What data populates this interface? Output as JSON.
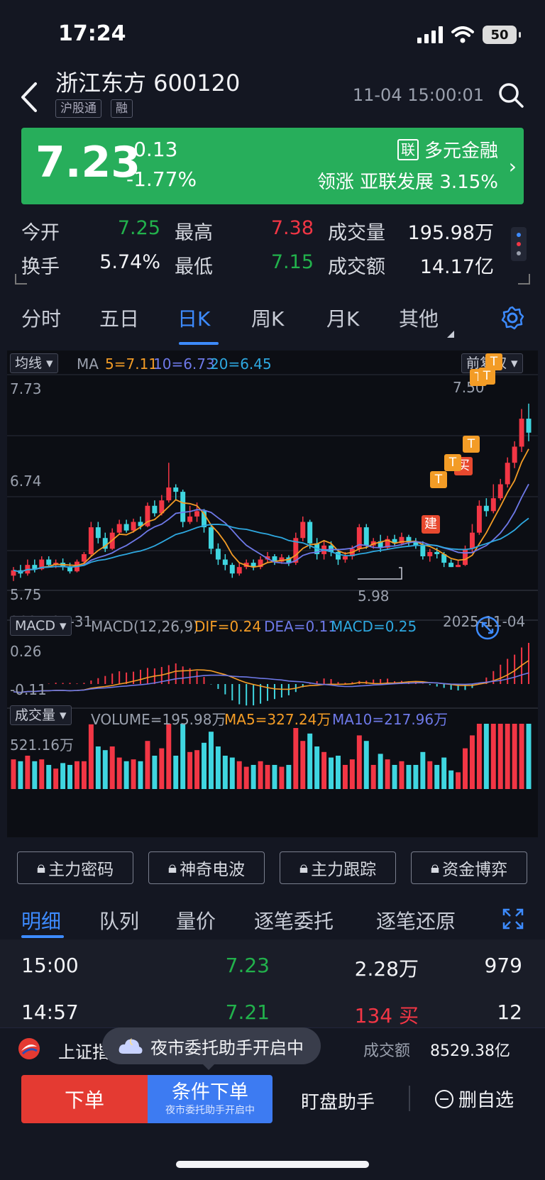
{
  "status": {
    "time": "17:24",
    "battery": "50"
  },
  "header": {
    "name": "浙江东方 600120",
    "tags": [
      "沪股通",
      "融"
    ],
    "datetime": "11-04 15:00:01"
  },
  "quote": {
    "price": "7.23",
    "change": "-0.13",
    "change_pct": "-1.77%",
    "sector_badge": "联",
    "sector_name": "多元金融",
    "lead_label": "领涨",
    "lead_stock": "亚联发展",
    "lead_pct": "3.15%"
  },
  "stats": [
    {
      "label": "今开",
      "value": "7.25"
    },
    {
      "label": "最高",
      "value": "7.38"
    },
    {
      "label": "成交量",
      "value": "195.98万"
    },
    {
      "label": "换手",
      "value": "5.74%"
    },
    {
      "label": "最低",
      "value": "7.15"
    },
    {
      "label": "成交额",
      "value": "14.17亿"
    }
  ],
  "period_tabs": [
    "分时",
    "五日",
    "日K",
    "周K",
    "月K",
    "其他"
  ],
  "chart": {
    "ma_dropdown": "均线",
    "ma_label": "MA",
    "ma5": "5=7.11",
    "ma10": "10=6.73",
    "ma20": "20=6.45",
    "adjust": "前复权",
    "price_ticks": [
      "7.73",
      "6.74",
      "5.75"
    ],
    "high_mark": "7.50",
    "low_mark": "5.98",
    "date_start": "2025-07-31",
    "date_end": "2025-11-04",
    "signal_build": "建",
    "signal_buy": "买",
    "signal_t": "T",
    "macd_dropdown": "MACD",
    "macd_label": "MACD(12,26,9)",
    "dif": "DIF=0.24",
    "dea": "DEA=0.11",
    "macd": "MACD=0.25",
    "macd_top": "0.26",
    "macd_bottom": "-0.11",
    "vol_dropdown": "成交量",
    "vol_label": "VOLUME=195.98万",
    "vol_ma5": "MA5=327.24万",
    "vol_ma10": "MA10=217.96万",
    "vol_top": "521.16万"
  },
  "features": [
    "主力密码",
    "神奇电波",
    "主力跟踪",
    "资金博弈"
  ],
  "detail_tabs": [
    "明细",
    "队列",
    "量价",
    "逐笔委托",
    "逐笔还原"
  ],
  "trades": [
    {
      "time": "15:00",
      "price": "7.23",
      "volume": "2.28万",
      "count": "979"
    },
    {
      "time": "14:57",
      "price": "7.21",
      "volume": "134 买",
      "count": "12"
    }
  ],
  "index_bar": {
    "name": "上证指",
    "turnover_label": "成交额",
    "turnover_value": "8529.38亿",
    "tooltip": "夜市委托助手开启中"
  },
  "bottom": {
    "order": "下单",
    "conditional": "条件下单",
    "conditional_sub": "夜市委托助手开启中",
    "monitor": "盯盘助手",
    "remove": "删自选"
  },
  "colors": {
    "up": "#f23645",
    "down": "#22b14c",
    "accent": "#3d8bff",
    "banner": "#27ae5b"
  },
  "chart_data": {
    "type": "candlestick",
    "title": "",
    "x_range": [
      "2025-07-31",
      "2025-11-04"
    ],
    "ylim": [
      5.75,
      7.73
    ],
    "candles": [
      [
        5.9,
        5.95,
        5.85,
        5.98
      ],
      [
        5.95,
        5.92,
        5.88,
        6.0
      ],
      [
        5.92,
        6.0,
        5.9,
        6.05
      ],
      [
        6.0,
        5.96,
        5.93,
        6.05
      ],
      [
        5.96,
        6.05,
        5.95,
        6.08
      ],
      [
        6.05,
        6.0,
        5.98,
        6.08
      ],
      [
        6.0,
        6.02,
        5.97,
        6.05
      ],
      [
        6.02,
        5.98,
        5.95,
        6.06
      ],
      [
        5.98,
        5.94,
        5.92,
        6.02
      ],
      [
        5.94,
        6.03,
        5.93,
        6.05
      ],
      [
        6.03,
        6.1,
        6.0,
        6.12
      ],
      [
        6.1,
        6.35,
        6.08,
        6.4
      ],
      [
        6.35,
        6.25,
        6.2,
        6.4
      ],
      [
        6.25,
        6.15,
        6.12,
        6.3
      ],
      [
        6.15,
        6.3,
        6.14,
        6.34
      ],
      [
        6.3,
        6.38,
        6.28,
        6.42
      ],
      [
        6.38,
        6.32,
        6.3,
        6.42
      ],
      [
        6.32,
        6.4,
        6.3,
        6.43
      ],
      [
        6.4,
        6.36,
        6.33,
        6.45
      ],
      [
        6.36,
        6.55,
        6.35,
        6.58
      ],
      [
        6.55,
        6.48,
        6.45,
        6.6
      ],
      [
        6.48,
        6.6,
        6.46,
        6.65
      ],
      [
        6.6,
        6.72,
        6.58,
        6.95
      ],
      [
        6.72,
        6.68,
        6.6,
        6.75
      ],
      [
        6.68,
        6.4,
        6.35,
        6.7
      ],
      [
        6.4,
        6.45,
        6.38,
        6.55
      ],
      [
        6.45,
        6.5,
        6.4,
        6.58
      ],
      [
        6.5,
        6.35,
        6.3,
        6.52
      ],
      [
        6.35,
        6.15,
        6.1,
        6.38
      ],
      [
        6.15,
        6.05,
        6.0,
        6.2
      ],
      [
        6.05,
        6.0,
        5.95,
        6.1
      ],
      [
        6.0,
        5.92,
        5.88,
        6.02
      ],
      [
        5.92,
        5.98,
        5.9,
        6.02
      ],
      [
        5.98,
        6.02,
        5.96,
        6.05
      ],
      [
        6.02,
        5.98,
        5.95,
        6.05
      ],
      [
        5.98,
        6.05,
        5.96,
        6.08
      ],
      [
        6.05,
        6.08,
        6.02,
        6.12
      ],
      [
        6.08,
        6.03,
        6.0,
        6.1
      ],
      [
        6.03,
        6.07,
        6.01,
        6.1
      ],
      [
        6.07,
        6.02,
        5.99,
        6.09
      ],
      [
        6.02,
        6.25,
        6.0,
        6.3
      ],
      [
        6.25,
        6.4,
        6.22,
        6.45
      ],
      [
        6.4,
        6.2,
        6.15,
        6.42
      ],
      [
        6.2,
        6.1,
        6.05,
        6.25
      ],
      [
        6.1,
        6.18,
        6.05,
        6.22
      ],
      [
        6.18,
        6.12,
        6.08,
        6.22
      ],
      [
        6.12,
        6.05,
        6.0,
        6.15
      ],
      [
        6.05,
        6.08,
        6.02,
        6.12
      ],
      [
        6.08,
        6.15,
        6.05,
        6.18
      ],
      [
        6.15,
        6.35,
        6.12,
        6.38
      ],
      [
        6.35,
        6.18,
        6.15,
        6.38
      ],
      [
        6.18,
        6.22,
        6.15,
        6.25
      ],
      [
        6.22,
        6.16,
        6.12,
        6.28
      ],
      [
        6.16,
        6.24,
        6.14,
        6.27
      ],
      [
        6.24,
        6.2,
        6.18,
        6.28
      ],
      [
        6.2,
        6.26,
        6.18,
        6.3
      ],
      [
        6.26,
        6.22,
        6.18,
        6.28
      ],
      [
        6.22,
        6.18,
        6.15,
        6.25
      ],
      [
        6.18,
        6.08,
        6.05,
        6.22
      ],
      [
        6.08,
        6.12,
        6.03,
        6.15
      ],
      [
        6.12,
        6.1,
        6.06,
        6.16
      ],
      [
        6.1,
        6.02,
        5.98,
        6.12
      ],
      [
        6.02,
        5.98,
        5.98,
        6.05
      ],
      [
        5.98,
        6.0,
        5.98,
        6.04
      ],
      [
        6.0,
        6.15,
        5.99,
        6.18
      ],
      [
        6.15,
        6.3,
        6.12,
        6.38
      ],
      [
        6.3,
        6.55,
        6.28,
        6.6
      ],
      [
        6.55,
        6.5,
        6.45,
        6.62
      ],
      [
        6.5,
        6.62,
        6.48,
        6.75
      ],
      [
        6.62,
        6.75,
        6.6,
        6.8
      ],
      [
        6.75,
        6.95,
        6.72,
        7.0
      ],
      [
        6.95,
        7.1,
        6.9,
        7.15
      ],
      [
        7.1,
        7.36,
        7.05,
        7.45
      ],
      [
        7.36,
        7.23,
        7.15,
        7.5
      ]
    ]
  }
}
